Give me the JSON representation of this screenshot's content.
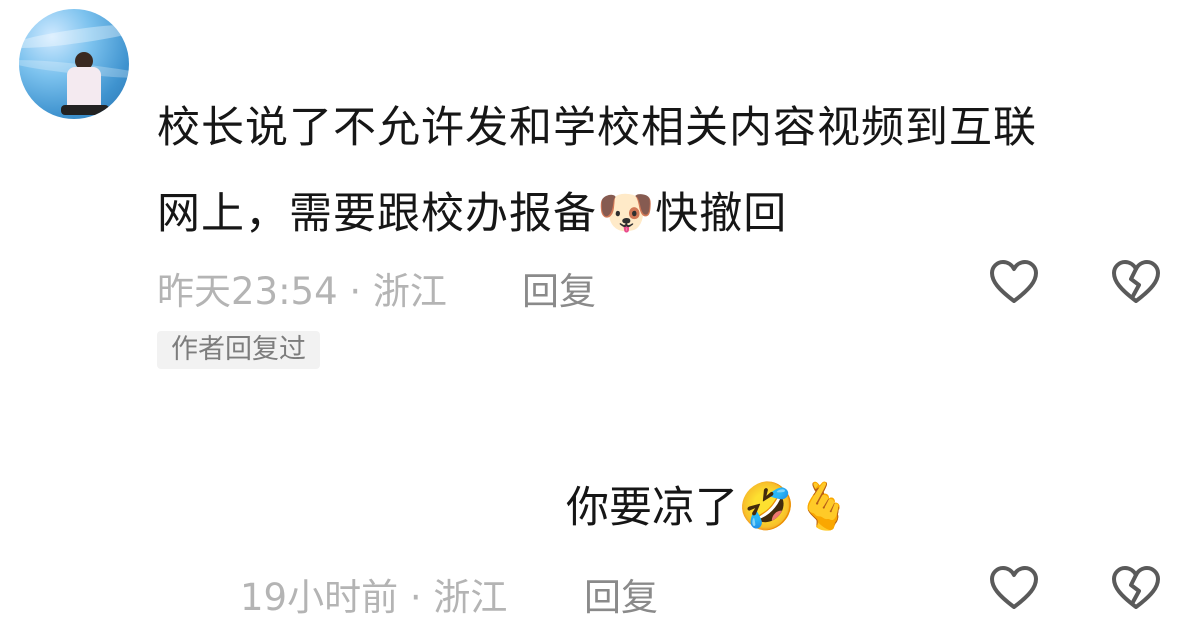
{
  "comment": {
    "avatar_icon": "user-avatar-photo",
    "text_line1": "校长说了不允许发和学校相关内容视频到互联",
    "text_line2_before": "网上，需要跟校办报备",
    "text_line2_emoji": "🐶",
    "text_line2_after": "快撤回",
    "meta": "昨天23:54 · 浙江",
    "reply_label": "回复",
    "author_badge": "作者回复过",
    "like_icon": "heart-outline-icon",
    "dislike_icon": "broken-heart-icon"
  },
  "reply": {
    "text": "你要凉了",
    "emoji_1": "🤣",
    "emoji_2": "🫰",
    "meta": "19小时前 · 浙江",
    "reply_label": "回复",
    "like_icon": "heart-outline-icon",
    "dislike_icon": "broken-heart-icon"
  },
  "colors": {
    "text": "#161616",
    "meta": "#b4b4b4",
    "reply": "#8a8a8a",
    "icon": "#5a5a5a",
    "badge_bg": "#f2f2f2"
  }
}
